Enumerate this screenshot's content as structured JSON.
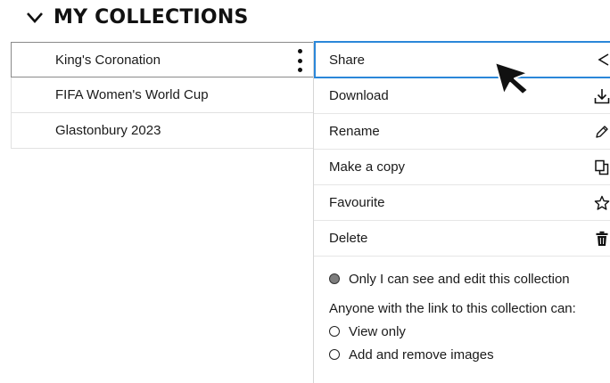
{
  "header": {
    "title": "MY COLLECTIONS",
    "chevron_icon": "chevron-down-icon"
  },
  "collections": [
    {
      "label": "King's Coronation",
      "active": true
    },
    {
      "label": "FIFA Women's World Cup",
      "active": false
    },
    {
      "label": "Glastonbury 2023",
      "active": false
    }
  ],
  "menu": {
    "items": [
      {
        "label": "Share",
        "icon": "share-icon"
      },
      {
        "label": "Download",
        "icon": "download-icon"
      },
      {
        "label": "Rename",
        "icon": "pencil-icon"
      },
      {
        "label": "Make a copy",
        "icon": "copy-icon"
      },
      {
        "label": "Favourite",
        "icon": "star-icon"
      },
      {
        "label": "Delete",
        "icon": "trash-icon"
      }
    ]
  },
  "share": {
    "private_option": "Only I can see and edit this collection",
    "link_heading": "Anyone with the link to this collection can:",
    "options": [
      "View only",
      "Add and remove images"
    ]
  },
  "colors": {
    "accent": "#2b87d9",
    "text": "#1a1a1a",
    "border": "#e1e1e1"
  }
}
